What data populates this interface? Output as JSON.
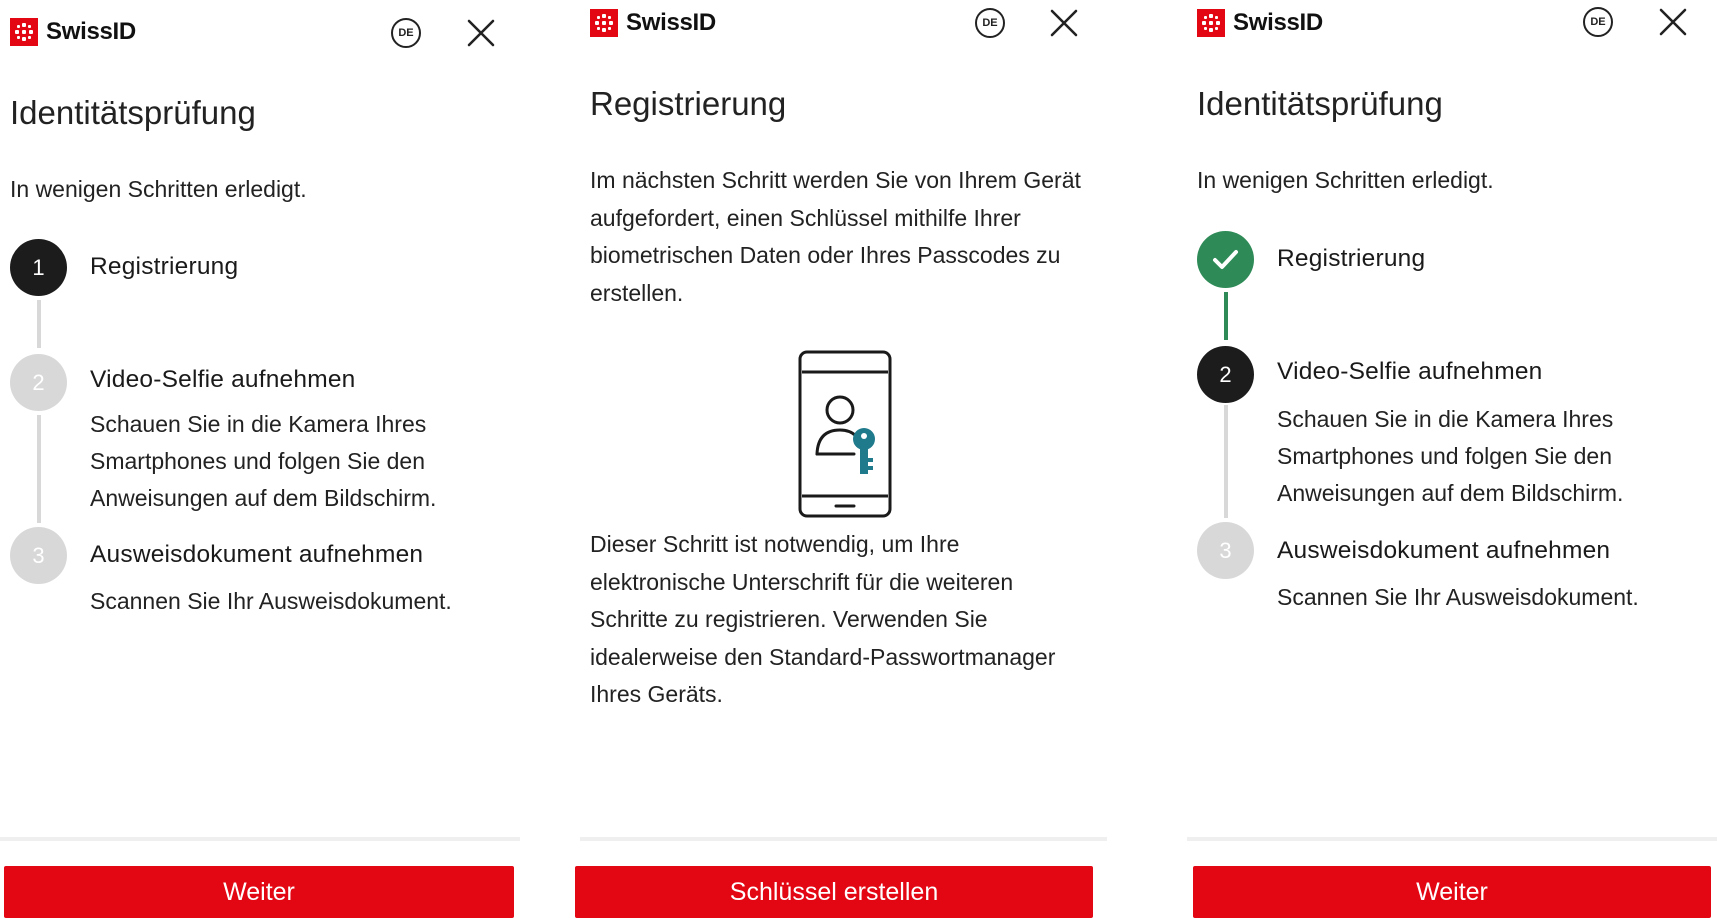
{
  "brand": {
    "name": "SwissID",
    "logo_color": "#e30613"
  },
  "language": "DE",
  "icons": {
    "close": "close-icon",
    "language": "language-badge",
    "check": "check-icon"
  },
  "colors": {
    "primary": "#e30613",
    "step_active": "#1c1c1c",
    "step_inactive": "#d8d8d8",
    "step_done": "#2e8b57",
    "key": "#1f7a8c"
  },
  "screens": [
    {
      "title": "Identitätsprüfung",
      "subtitle": "In wenigen Schritten erledigt.",
      "steps": [
        {
          "number": "1",
          "label": "Registrierung",
          "state": "active"
        },
        {
          "number": "2",
          "label": "Video-Selfie aufnehmen",
          "state": "inactive",
          "description": "Schauen Sie in die Kamera Ihres Smartphones und folgen Sie den Anweisungen auf dem Bildschirm."
        },
        {
          "number": "3",
          "label": "Ausweisdokument aufnehmen",
          "state": "inactive",
          "description": "Scannen Sie Ihr Ausweisdokument."
        }
      ],
      "button": "Weiter"
    },
    {
      "title": "Registrierung",
      "intro": "Im nächsten Schritt werden Sie von Ihrem Gerät aufgefordert, einen Schlüssel mithilfe Ihrer biometrischen Daten oder Ihres Passcodes zu erstellen.",
      "illustration": "phone-user-key-icon",
      "note": "Dieser Schritt ist notwendig, um Ihre elektronische Unterschrift für die weiteren Schritte zu registrieren. Verwenden Sie idealerweise den Standard-Passwortmanager Ihres Geräts.",
      "button": "Schlüssel erstellen"
    },
    {
      "title": "Identitätsprüfung",
      "subtitle": "In wenigen Schritten erledigt.",
      "steps": [
        {
          "number": "1",
          "label": "Registrierung",
          "state": "done"
        },
        {
          "number": "2",
          "label": "Video-Selfie aufnehmen",
          "state": "active",
          "description": "Schauen Sie in die Kamera Ihres Smartphones und folgen Sie den Anweisungen auf dem Bildschirm."
        },
        {
          "number": "3",
          "label": "Ausweisdokument aufnehmen",
          "state": "inactive",
          "description": "Scannen Sie Ihr Ausweisdokument."
        }
      ],
      "button": "Weiter"
    }
  ]
}
